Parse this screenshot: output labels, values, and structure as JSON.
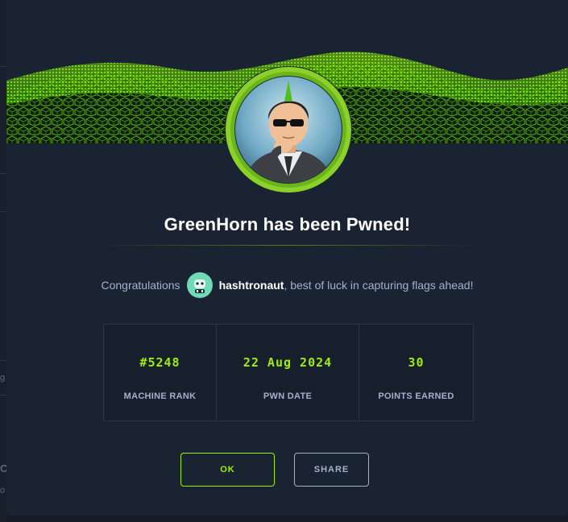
{
  "modal": {
    "title": "GreenHorn has been Pwned!",
    "congrats": {
      "prefix": "Congratulations",
      "username": "hashtronaut",
      "suffix": ", best of luck in capturing flags ahead!"
    },
    "stats": [
      {
        "value": "#5248",
        "label": "MACHINE RANK"
      },
      {
        "value": "22 Aug 2024",
        "label": "PWN DATE"
      },
      {
        "value": "30",
        "label": "POINTS EARNED"
      }
    ],
    "buttons": {
      "ok": "OK",
      "share": "SHARE"
    }
  },
  "background": {
    "glyphs": [
      "g",
      "C",
      "o"
    ]
  },
  "colors": {
    "accent": "#9fef00",
    "panel": "#1a2332",
    "muted_text": "#a4b1cd",
    "title": "#ffffff"
  },
  "icons": {
    "machine_avatar": "greenhorn-machine-avatar",
    "user_avatar": "hashtronaut-user-avatar"
  }
}
